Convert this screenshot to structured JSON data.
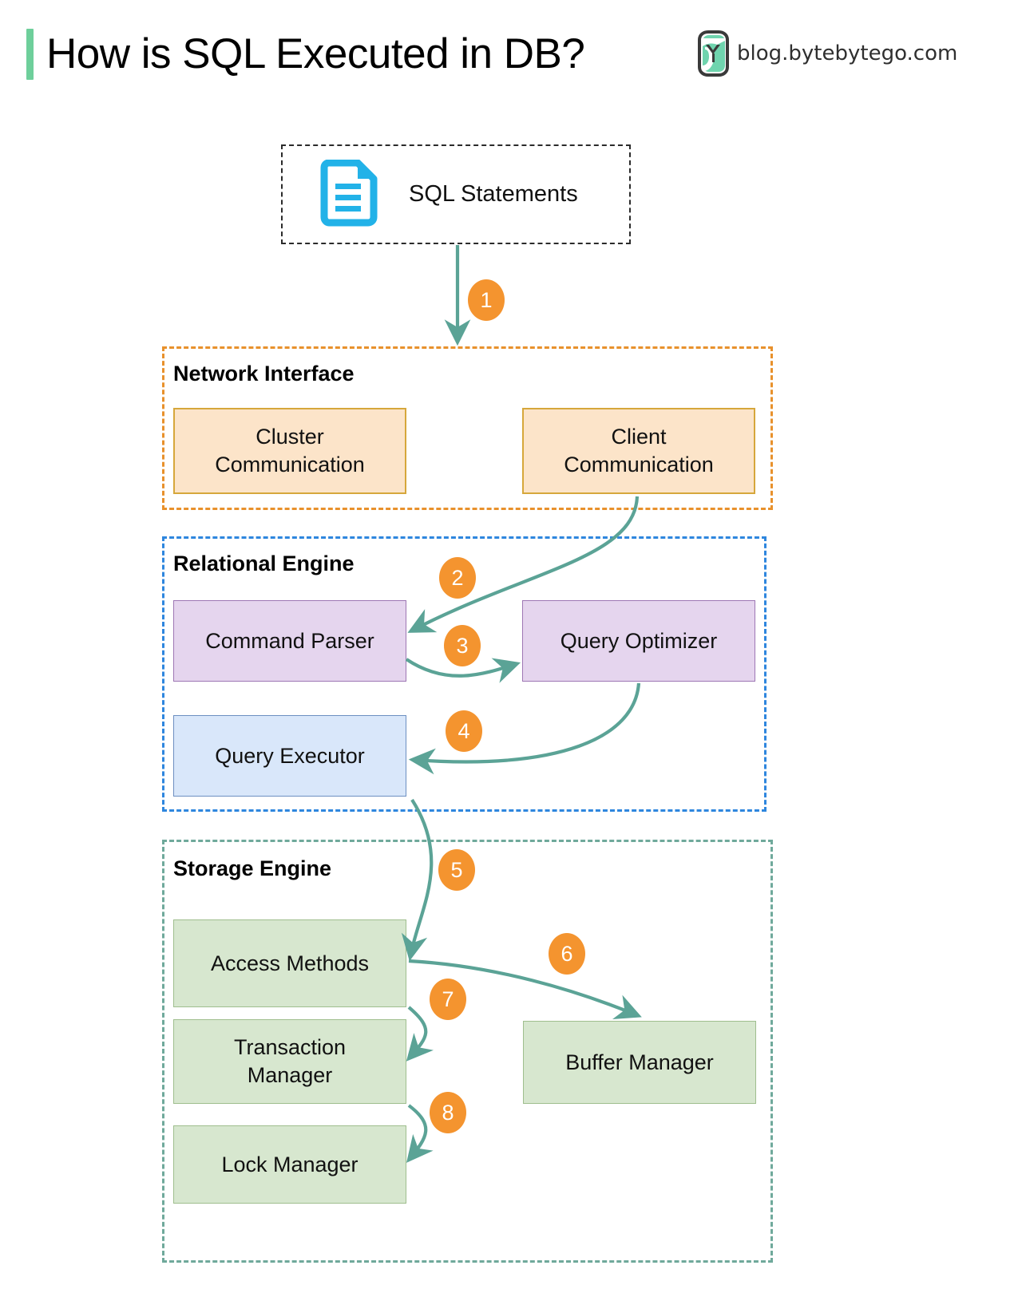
{
  "header": {
    "title": "How is SQL Executed in DB?",
    "brand": "blog.bytebytego.com",
    "accent_color": "#6ECf9B",
    "logo_name": "bytebytego-logo"
  },
  "source": {
    "label": "SQL Statements",
    "icon": "document-icon",
    "icon_color": "#22B2E8"
  },
  "groups": [
    {
      "id": "network-interface",
      "title": "Network Interface",
      "border_color": "#E8912C"
    },
    {
      "id": "relational-engine",
      "title": "Relational Engine",
      "border_color": "#2E86DE"
    },
    {
      "id": "storage-engine",
      "title": "Storage Engine",
      "border_color": "#6FA99B"
    }
  ],
  "nodes": {
    "cluster_communication": "Cluster\nCommunication",
    "cluster_communication_line1": "Cluster",
    "cluster_communication_line2": "Communication",
    "client_communication_line1": "Client",
    "client_communication_line2": "Communication",
    "command_parser": "Command Parser",
    "query_optimizer": "Query Optimizer",
    "query_executor": "Query Executor",
    "access_methods": "Access Methods",
    "transaction_manager_line1": "Transaction",
    "transaction_manager_line2": "Manager",
    "lock_manager": "Lock Manager",
    "buffer_manager": "Buffer Manager"
  },
  "steps": [
    {
      "n": "1",
      "from": "SQL Statements",
      "to": "Network Interface"
    },
    {
      "n": "2",
      "from": "Client Communication",
      "to": "Command Parser"
    },
    {
      "n": "3",
      "from": "Command Parser",
      "to": "Query Optimizer"
    },
    {
      "n": "4",
      "from": "Query Optimizer",
      "to": "Query Executor"
    },
    {
      "n": "5",
      "from": "Query Executor",
      "to": "Access Methods"
    },
    {
      "n": "6",
      "from": "Access Methods",
      "to": "Buffer Manager"
    },
    {
      "n": "7",
      "from": "Access Methods",
      "to": "Transaction Manager"
    },
    {
      "n": "8",
      "from": "Transaction Manager",
      "to": "Lock Manager"
    }
  ],
  "colors": {
    "arrow": "#5BA396",
    "badge": "#F4942F",
    "badge_text": "#FFFFFF",
    "peach_fill": "#FCE4C9",
    "peach_border": "#D6A73B",
    "purple_fill": "#E5D5EE",
    "purple_border": "#9E77B4",
    "blue_fill": "#D9E7FA",
    "blue_border": "#6D8FC1",
    "green_fill": "#D7E7CF",
    "green_border": "#9FBE8E"
  }
}
